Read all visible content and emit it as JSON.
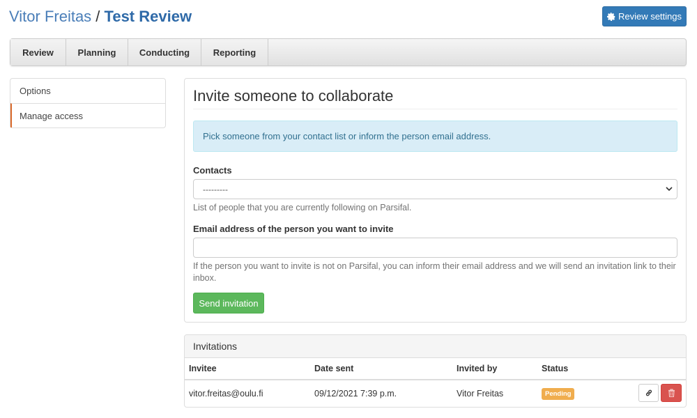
{
  "header": {
    "owner": "Vitor Freitas",
    "separator": " / ",
    "review_title": "Test Review",
    "settings_button": "Review settings",
    "settings_icon": "gear-icon"
  },
  "nav": {
    "tabs": [
      {
        "label": "Review"
      },
      {
        "label": "Planning"
      },
      {
        "label": "Conducting"
      },
      {
        "label": "Reporting"
      }
    ]
  },
  "sidebar": {
    "items": [
      {
        "label": "Options",
        "active": false
      },
      {
        "label": "Manage access",
        "active": true
      }
    ],
    "active_color": "#d9692a"
  },
  "invite": {
    "title": "Invite someone to collaborate",
    "alert": "Pick someone from your contact list or inform the person email address.",
    "contacts_label": "Contacts",
    "contacts_selected": "---------",
    "contacts_help": "List of people that you are currently following on Parsifal.",
    "email_label": "Email address of the person you want to invite",
    "email_value": "",
    "email_help": "If the person you want to invite is not on Parsifal, you can inform their email address and we will send an invitation link to their inbox.",
    "send_button": "Send invitation"
  },
  "invitations": {
    "title": "Invitations",
    "columns": [
      "Invitee",
      "Date sent",
      "Invited by",
      "Status"
    ],
    "rows": [
      {
        "invitee": "vitor.freitas@oulu.fi",
        "date_sent": "09/12/2021 7:39 p.m.",
        "invited_by": "Vitor Freitas",
        "status": "Pending",
        "status_color": "#f0ad4e",
        "actions": [
          "link-icon",
          "trash-icon"
        ]
      }
    ]
  }
}
